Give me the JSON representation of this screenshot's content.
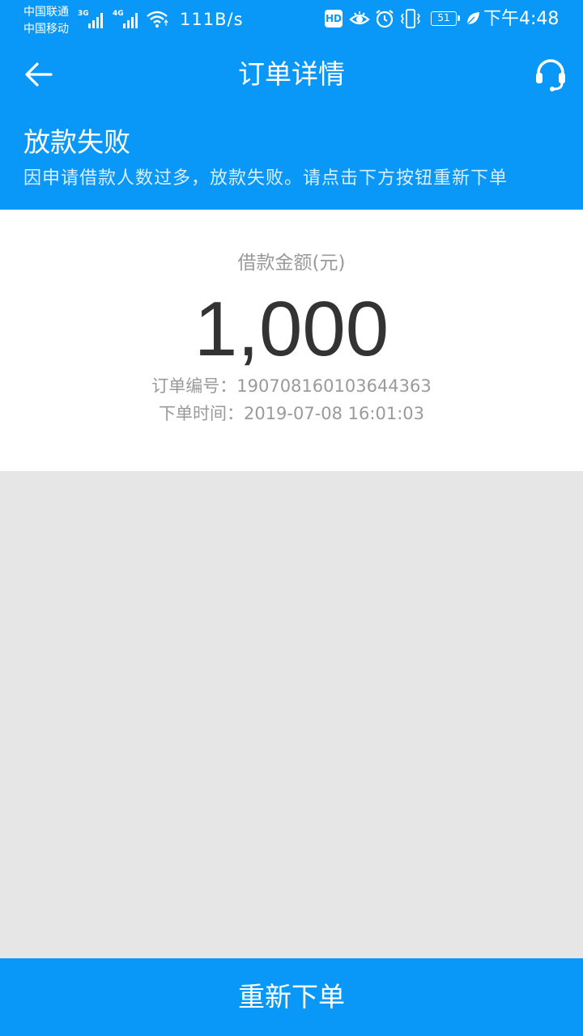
{
  "status_bar": {
    "carrier_1": "中国联通",
    "carrier_2": "中国移动",
    "network_1": "3G",
    "network_2": "4G",
    "net_speed": "111B/s",
    "hd_badge": "HD",
    "battery_level": "51",
    "time": "下午4:48",
    "icons": [
      "signal-icon",
      "wifi-icon",
      "eye-icon",
      "alarm-icon",
      "vibrate-icon",
      "battery-icon",
      "leaf-icon"
    ]
  },
  "header": {
    "back_icon": "arrow-left-icon",
    "title": "订单详情",
    "service_icon": "headset-icon"
  },
  "banner": {
    "title": "放款失败",
    "subtitle": "因申请借款人数过多，放款失败。请点击下方按钮重新下单"
  },
  "order": {
    "amount_label": "借款金额(元)",
    "amount": "1,000",
    "order_no_label": "订单编号：",
    "order_no": "190708160103644363",
    "order_time_label": "下单时间：",
    "order_time": "2019-07-08 16:01:03"
  },
  "footer": {
    "button_label": "重新下单"
  },
  "colors": {
    "primary": "#0a98f8",
    "background": "#e6e6e6",
    "card": "#ffffff",
    "amount_text": "#333333",
    "muted_text": "#9a9a9a"
  }
}
